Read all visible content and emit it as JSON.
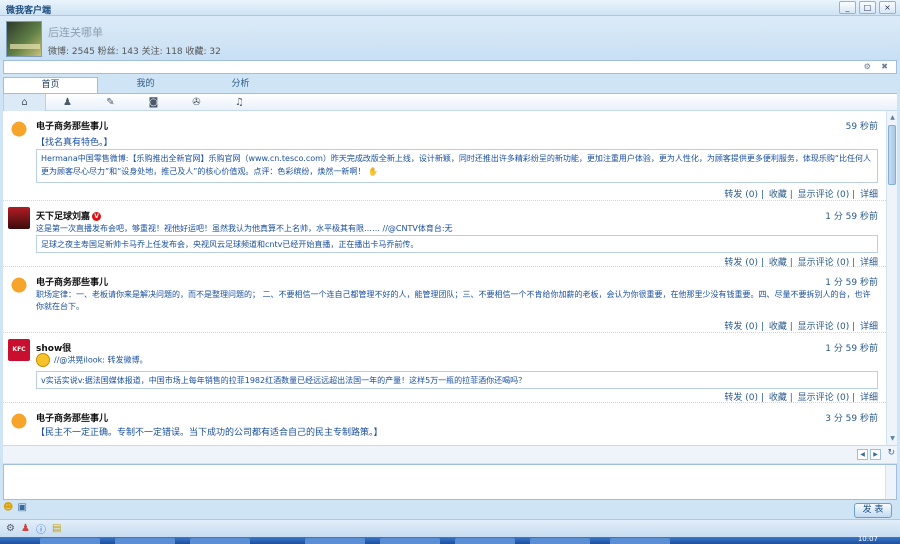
{
  "window": {
    "title": "微我客户端",
    "buttons": [
      "_",
      "□",
      "×"
    ]
  },
  "profile": {
    "signature": "后连关哪单",
    "stats": "微博: 2545 粉丝: 143 关注: 118 收藏: 32"
  },
  "search": {
    "value": ""
  },
  "strip_icons": "⚙ ✖",
  "tabs": [
    {
      "label": "首页",
      "active": true
    },
    {
      "label": "我的",
      "active": false
    },
    {
      "label": "分析",
      "active": false
    }
  ],
  "nav_icons": [
    "home-icon",
    "user-icon",
    "edit-icon",
    "camera-icon",
    "film-icon",
    "music-icon"
  ],
  "nav_glyphs": [
    "⌂",
    "♟",
    "✎",
    "◙",
    "✇",
    "♫"
  ],
  "posts": [
    {
      "user": "电子商务那些事儿",
      "time": "59 秒前",
      "text": "【找名真有特色。】",
      "quote": "Hermana中国零售微博:【乐购推出全新官网】乐购官网（www.cn.tesco.com）昨天完成改版全新上线，设计新颖，同时还推出许多精彩纷呈的新功能，更加注重用户体验，更为人性化，为顾客提供更多便利服务，体现乐购“比任何人更为顾客尽心尽力”和“设身处地，推己及人”的核心价值观。点评：色彩缤纷，焕然一新啊！",
      "actions": {
        "forward": "转发 (0)",
        "fav": "收藏",
        "comment": "显示评论 (0)",
        "detail": "详细"
      }
    },
    {
      "user": "天下足球刘嘉",
      "time": "1 分 59 秒前",
      "text": "这是第一次直播发布会吧，够重视！视他好运吧！虽然我认为他真算不上名帅，水平极其有限…… //@CNTV体育台:无",
      "quote": "足球之夜主寿国足新帅卡马乔上任发布会，央视风云足球频道和cntv已经开始直播，正在播出卡马乔前传。",
      "actions": {
        "forward": "转发 (0)",
        "fav": "收藏",
        "comment": "显示评论 (0)",
        "detail": "详细"
      }
    },
    {
      "user": "电子商务那些事儿",
      "time": "1 分 59 秒前",
      "text": "职场定律：一、老板请你来是解决问题的，而不是整理问题的； 二、不要相信一个连自己都管理不好的人，能管理团队；三、不要相信一个不肯给你加薪的老板，会认为你很重要，在他那里少没有钱重要。四、尽量不要拆别人的台，也许你就在台下。",
      "actions": {
        "forward": "转发 (0)",
        "fav": "收藏",
        "comment": "显示评论 (0)",
        "detail": "详细"
      }
    },
    {
      "user": "show很",
      "time": "1 分 59 秒前",
      "text": "//@洪晃ilook: 转发微博。",
      "quote": "v实话实说v:据法国媒体报道，中国市场上每年销售的拉菲1982红酒数量已经远远超出法国一年的产量！这样5万一瓶的拉菲酒你还喝吗？",
      "actions": {
        "forward": "转发 (0)",
        "fav": "收藏",
        "comment": "显示评论 (0)",
        "detail": "详细"
      }
    },
    {
      "user": "电子商务那些事儿",
      "time": "3 分 59 秒前",
      "text": "【民主不一定正确。专制不一定错误。当下成功的公司都有适合自己的民主专制路策。】"
    }
  ],
  "composer": {
    "placeholder": ""
  },
  "send_label": "发 表",
  "taskbar": {
    "clock": "10:07"
  }
}
